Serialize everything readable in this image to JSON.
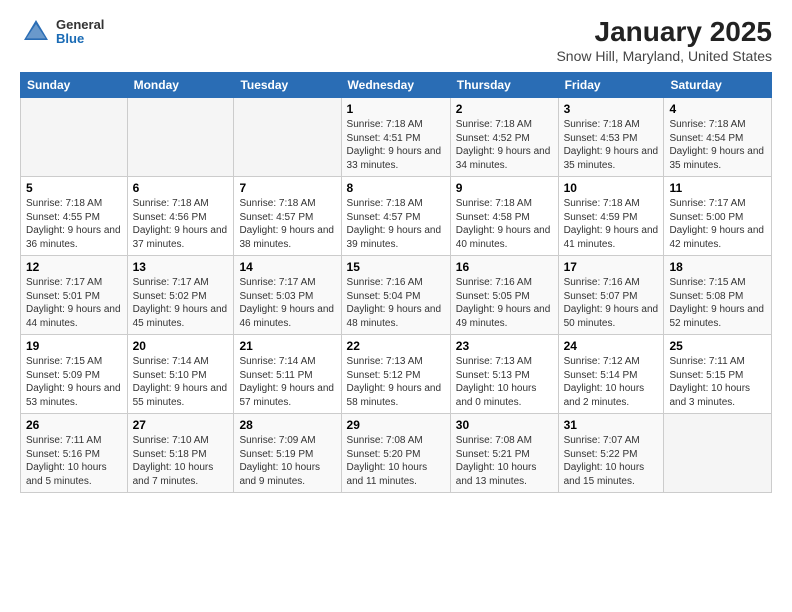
{
  "header": {
    "logo_general": "General",
    "logo_blue": "Blue",
    "title": "January 2025",
    "subtitle": "Snow Hill, Maryland, United States"
  },
  "columns": [
    "Sunday",
    "Monday",
    "Tuesday",
    "Wednesday",
    "Thursday",
    "Friday",
    "Saturday"
  ],
  "weeks": [
    [
      {
        "day": "",
        "content": ""
      },
      {
        "day": "",
        "content": ""
      },
      {
        "day": "",
        "content": ""
      },
      {
        "day": "1",
        "content": "Sunrise: 7:18 AM\nSunset: 4:51 PM\nDaylight: 9 hours and 33 minutes."
      },
      {
        "day": "2",
        "content": "Sunrise: 7:18 AM\nSunset: 4:52 PM\nDaylight: 9 hours and 34 minutes."
      },
      {
        "day": "3",
        "content": "Sunrise: 7:18 AM\nSunset: 4:53 PM\nDaylight: 9 hours and 35 minutes."
      },
      {
        "day": "4",
        "content": "Sunrise: 7:18 AM\nSunset: 4:54 PM\nDaylight: 9 hours and 35 minutes."
      }
    ],
    [
      {
        "day": "5",
        "content": "Sunrise: 7:18 AM\nSunset: 4:55 PM\nDaylight: 9 hours and 36 minutes."
      },
      {
        "day": "6",
        "content": "Sunrise: 7:18 AM\nSunset: 4:56 PM\nDaylight: 9 hours and 37 minutes."
      },
      {
        "day": "7",
        "content": "Sunrise: 7:18 AM\nSunset: 4:57 PM\nDaylight: 9 hours and 38 minutes."
      },
      {
        "day": "8",
        "content": "Sunrise: 7:18 AM\nSunset: 4:57 PM\nDaylight: 9 hours and 39 minutes."
      },
      {
        "day": "9",
        "content": "Sunrise: 7:18 AM\nSunset: 4:58 PM\nDaylight: 9 hours and 40 minutes."
      },
      {
        "day": "10",
        "content": "Sunrise: 7:18 AM\nSunset: 4:59 PM\nDaylight: 9 hours and 41 minutes."
      },
      {
        "day": "11",
        "content": "Sunrise: 7:17 AM\nSunset: 5:00 PM\nDaylight: 9 hours and 42 minutes."
      }
    ],
    [
      {
        "day": "12",
        "content": "Sunrise: 7:17 AM\nSunset: 5:01 PM\nDaylight: 9 hours and 44 minutes."
      },
      {
        "day": "13",
        "content": "Sunrise: 7:17 AM\nSunset: 5:02 PM\nDaylight: 9 hours and 45 minutes."
      },
      {
        "day": "14",
        "content": "Sunrise: 7:17 AM\nSunset: 5:03 PM\nDaylight: 9 hours and 46 minutes."
      },
      {
        "day": "15",
        "content": "Sunrise: 7:16 AM\nSunset: 5:04 PM\nDaylight: 9 hours and 48 minutes."
      },
      {
        "day": "16",
        "content": "Sunrise: 7:16 AM\nSunset: 5:05 PM\nDaylight: 9 hours and 49 minutes."
      },
      {
        "day": "17",
        "content": "Sunrise: 7:16 AM\nSunset: 5:07 PM\nDaylight: 9 hours and 50 minutes."
      },
      {
        "day": "18",
        "content": "Sunrise: 7:15 AM\nSunset: 5:08 PM\nDaylight: 9 hours and 52 minutes."
      }
    ],
    [
      {
        "day": "19",
        "content": "Sunrise: 7:15 AM\nSunset: 5:09 PM\nDaylight: 9 hours and 53 minutes."
      },
      {
        "day": "20",
        "content": "Sunrise: 7:14 AM\nSunset: 5:10 PM\nDaylight: 9 hours and 55 minutes."
      },
      {
        "day": "21",
        "content": "Sunrise: 7:14 AM\nSunset: 5:11 PM\nDaylight: 9 hours and 57 minutes."
      },
      {
        "day": "22",
        "content": "Sunrise: 7:13 AM\nSunset: 5:12 PM\nDaylight: 9 hours and 58 minutes."
      },
      {
        "day": "23",
        "content": "Sunrise: 7:13 AM\nSunset: 5:13 PM\nDaylight: 10 hours and 0 minutes."
      },
      {
        "day": "24",
        "content": "Sunrise: 7:12 AM\nSunset: 5:14 PM\nDaylight: 10 hours and 2 minutes."
      },
      {
        "day": "25",
        "content": "Sunrise: 7:11 AM\nSunset: 5:15 PM\nDaylight: 10 hours and 3 minutes."
      }
    ],
    [
      {
        "day": "26",
        "content": "Sunrise: 7:11 AM\nSunset: 5:16 PM\nDaylight: 10 hours and 5 minutes."
      },
      {
        "day": "27",
        "content": "Sunrise: 7:10 AM\nSunset: 5:18 PM\nDaylight: 10 hours and 7 minutes."
      },
      {
        "day": "28",
        "content": "Sunrise: 7:09 AM\nSunset: 5:19 PM\nDaylight: 10 hours and 9 minutes."
      },
      {
        "day": "29",
        "content": "Sunrise: 7:08 AM\nSunset: 5:20 PM\nDaylight: 10 hours and 11 minutes."
      },
      {
        "day": "30",
        "content": "Sunrise: 7:08 AM\nSunset: 5:21 PM\nDaylight: 10 hours and 13 minutes."
      },
      {
        "day": "31",
        "content": "Sunrise: 7:07 AM\nSunset: 5:22 PM\nDaylight: 10 hours and 15 minutes."
      },
      {
        "day": "",
        "content": ""
      }
    ]
  ]
}
